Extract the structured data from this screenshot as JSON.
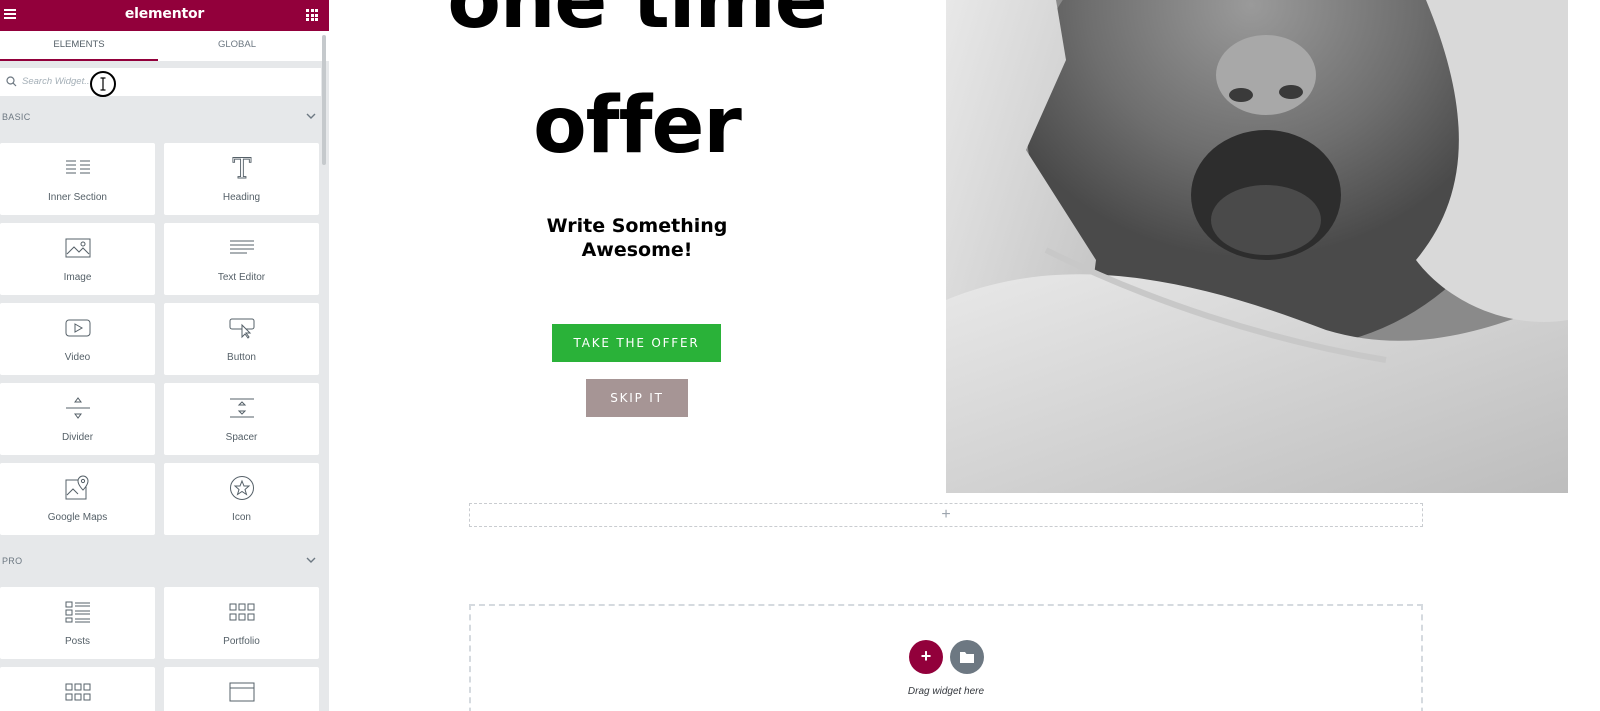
{
  "app": {
    "logo": "elementor",
    "brand_color": "#92003b"
  },
  "tabs": [
    {
      "label": "ELEMENTS",
      "active": true
    },
    {
      "label": "GLOBAL",
      "active": false
    }
  ],
  "search": {
    "placeholder": "Search Widget..."
  },
  "sections": {
    "basic": {
      "title": "BASIC",
      "widgets": [
        {
          "label": "Inner Section",
          "icon": "inner-section-icon"
        },
        {
          "label": "Heading",
          "icon": "heading-icon"
        },
        {
          "label": "Image",
          "icon": "image-icon"
        },
        {
          "label": "Text Editor",
          "icon": "text-editor-icon"
        },
        {
          "label": "Video",
          "icon": "video-icon"
        },
        {
          "label": "Button",
          "icon": "button-icon"
        },
        {
          "label": "Divider",
          "icon": "divider-icon"
        },
        {
          "label": "Spacer",
          "icon": "spacer-icon"
        },
        {
          "label": "Google Maps",
          "icon": "google-maps-icon"
        },
        {
          "label": "Icon",
          "icon": "star-icon"
        }
      ]
    },
    "pro": {
      "title": "PRO",
      "widgets": [
        {
          "label": "Posts",
          "icon": "posts-icon"
        },
        {
          "label": "Portfolio",
          "icon": "portfolio-icon"
        }
      ]
    }
  },
  "canvas": {
    "headline_line1": "one time",
    "headline_line2": "offer",
    "subheading": "Write Something Awesome!",
    "offer_button": "TAKE THE OFFER",
    "offer_button_color": "#2ab239",
    "skip_button": "SKIP IT",
    "skip_button_color": "#a69595",
    "add_row_symbol": "+",
    "add_section_symbol": "+",
    "drag_text": "Drag widget here"
  }
}
